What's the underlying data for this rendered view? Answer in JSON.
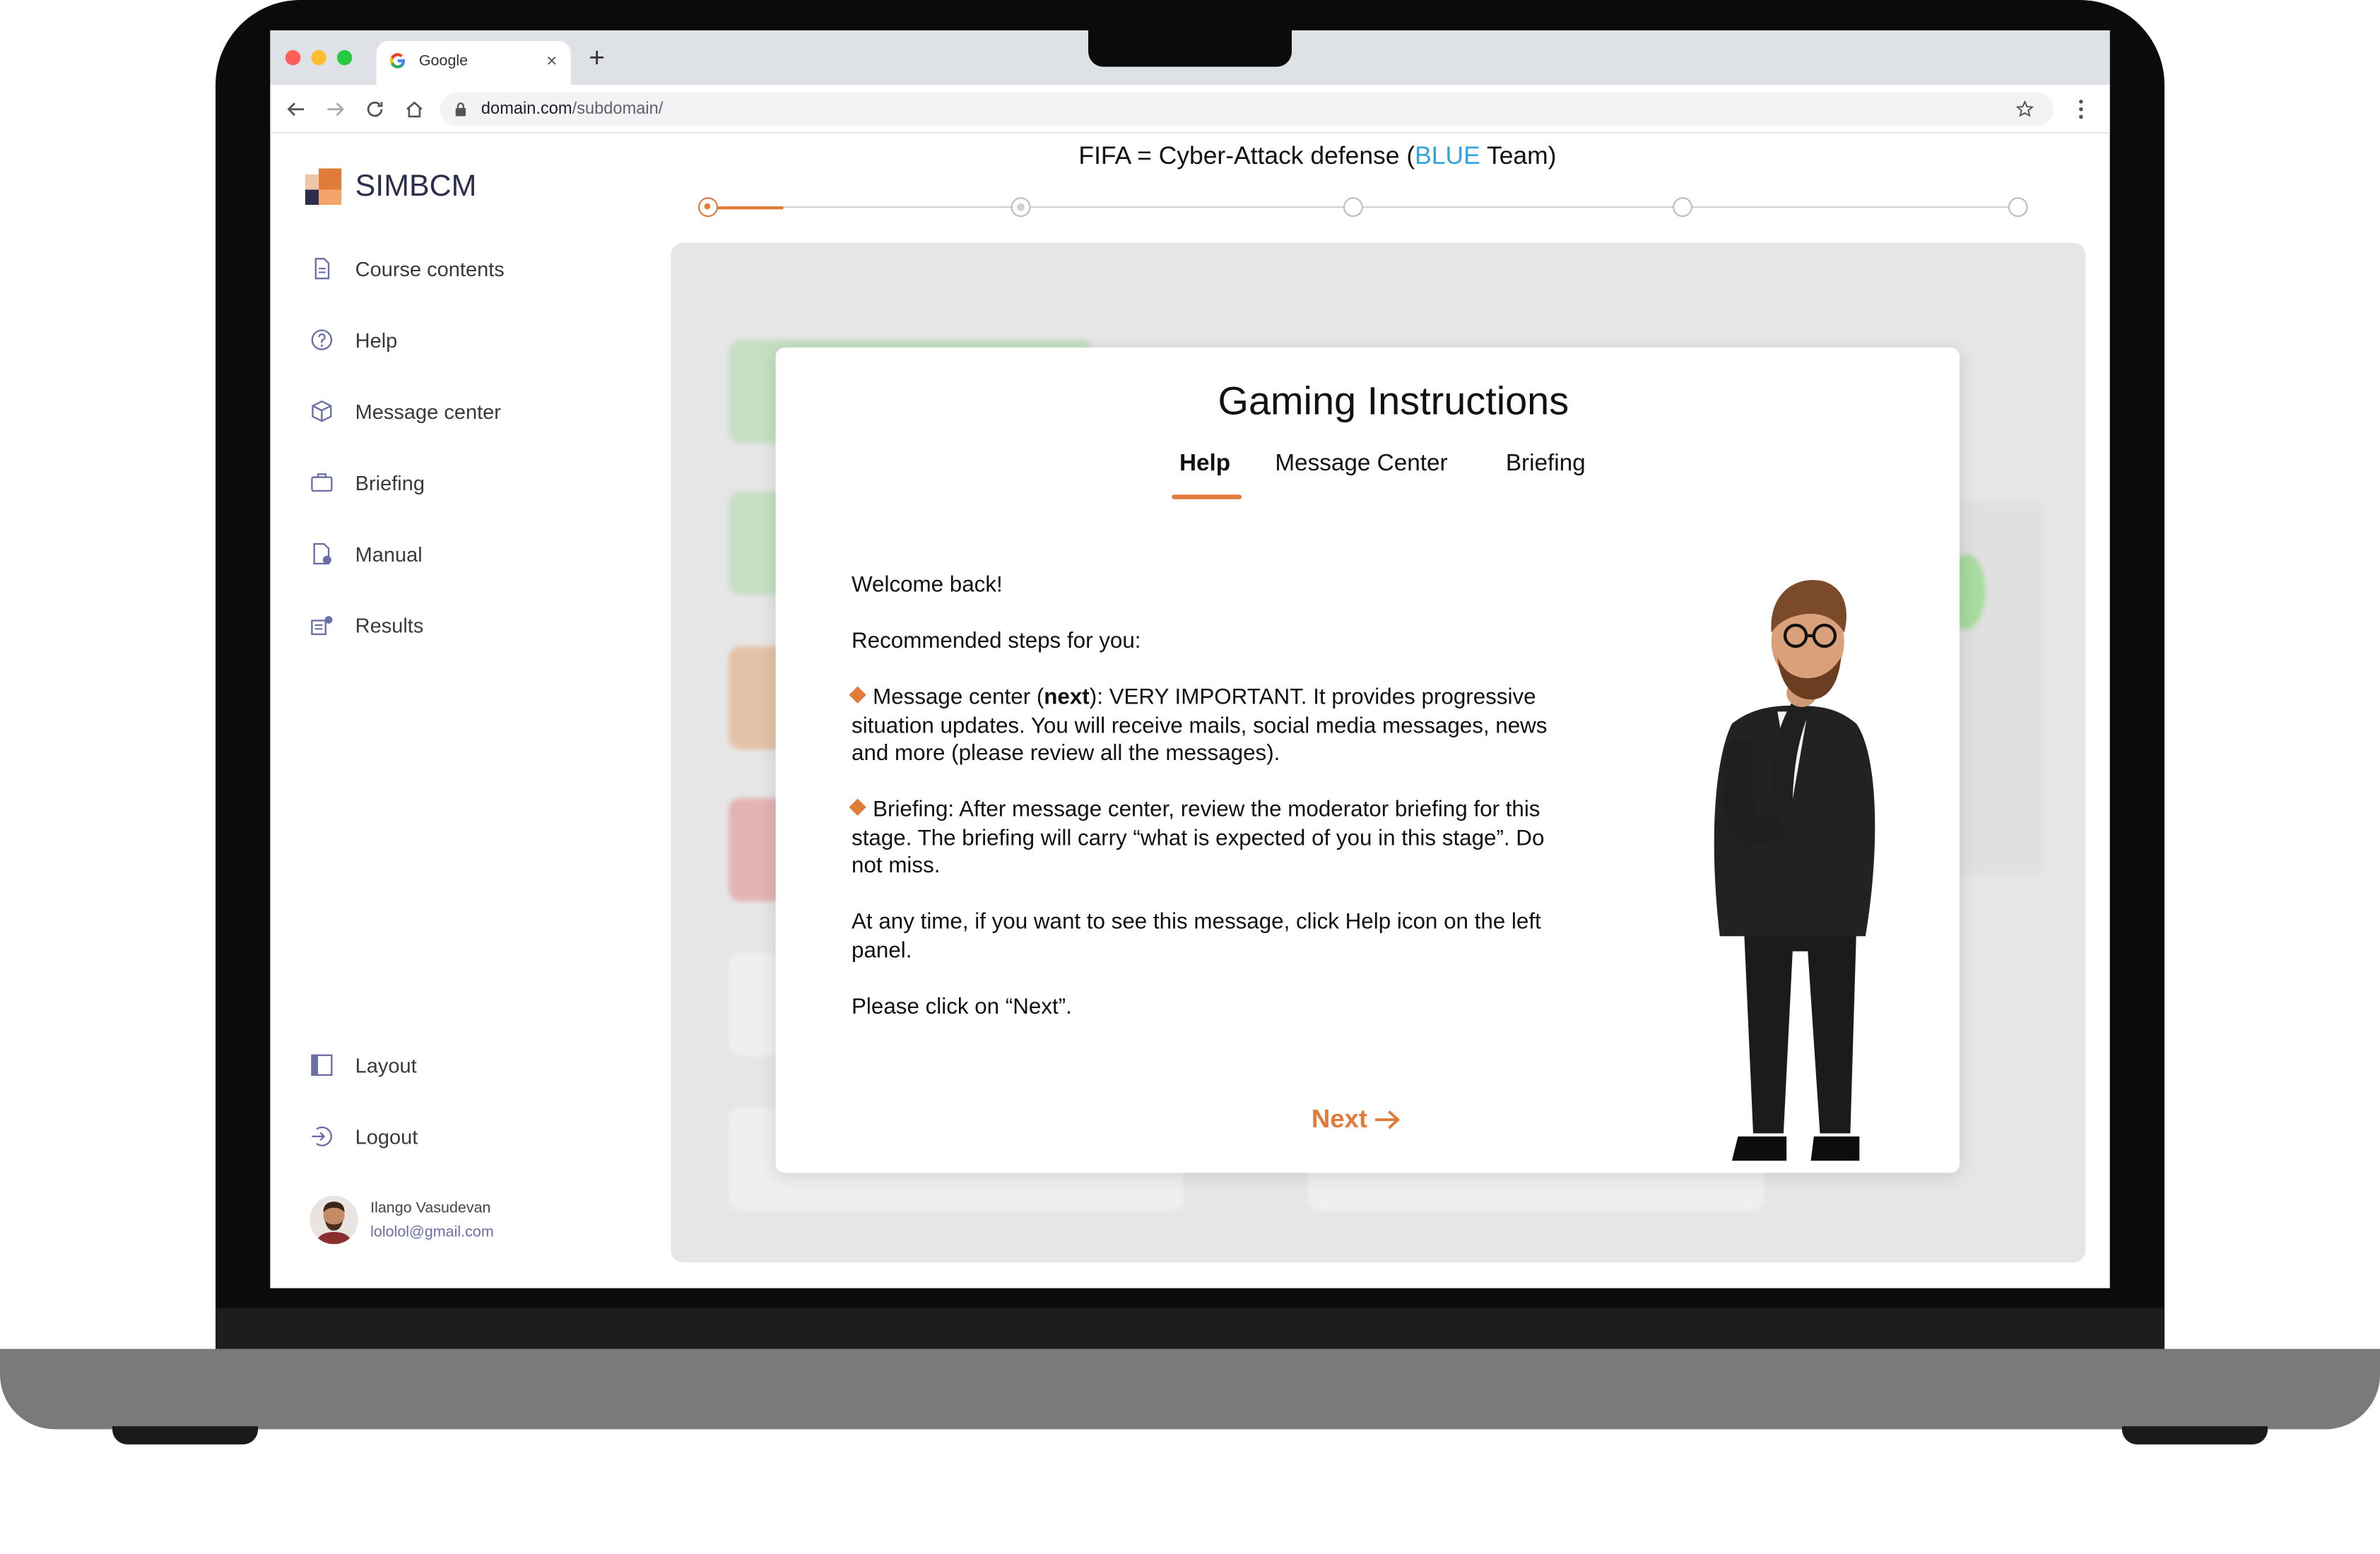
{
  "browser": {
    "tab_title": "Google",
    "new_tab_symbol": "+",
    "close_symbol": "×",
    "url_host": "domain.com",
    "url_path": "/subdomain/"
  },
  "app": {
    "logo": "SIMBCM",
    "page_title_prefix": "FIFA = Cyber-Attack defense (",
    "page_title_highlight": "BLUE",
    "page_title_suffix": " Team)"
  },
  "sidebar": {
    "items": [
      {
        "label": "Course contents",
        "icon": "document-icon"
      },
      {
        "label": "Help",
        "icon": "question-icon"
      },
      {
        "label": "Message center",
        "icon": "cube-icon"
      },
      {
        "label": "Briefing",
        "icon": "briefcase-icon"
      },
      {
        "label": "Manual",
        "icon": "manual-icon"
      },
      {
        "label": "Results",
        "icon": "results-icon"
      }
    ],
    "bottom_items": [
      {
        "label": "Layout",
        "icon": "layout-icon"
      },
      {
        "label": "Logout",
        "icon": "logout-icon"
      }
    ],
    "user": {
      "name": "Ilango Vasudevan",
      "email": "lololol@gmail.com"
    }
  },
  "modal": {
    "title": "Gaming Instructions",
    "tabs": [
      {
        "label": "Help",
        "active": true
      },
      {
        "label": "Message Center",
        "active": false
      },
      {
        "label": "Briefing",
        "active": false
      }
    ],
    "welcome": "Welcome back!",
    "steps_heading": "Recommended steps for you:",
    "bullet1_pre": "Message center (",
    "bullet1_bold": "next",
    "bullet1_post": "): VERY IMPORTANT. It provides progressive situation updates. You will receive mails, social media messages, news and more (please review all the messages).",
    "bullet2": "Briefing: After message center, review the moderator briefing for this stage. The briefing will carry “what is expected of you in this stage”. Do not miss.",
    "help_note": "At any time, if you want to see this message, click Help icon on the left panel.",
    "click_next": "Please click on “Next”.",
    "next_label": "Next"
  },
  "colors": {
    "accent": "#e07b39",
    "blue_highlight": "#2fa4e0",
    "sidebar_text": "#3a3a3a"
  }
}
